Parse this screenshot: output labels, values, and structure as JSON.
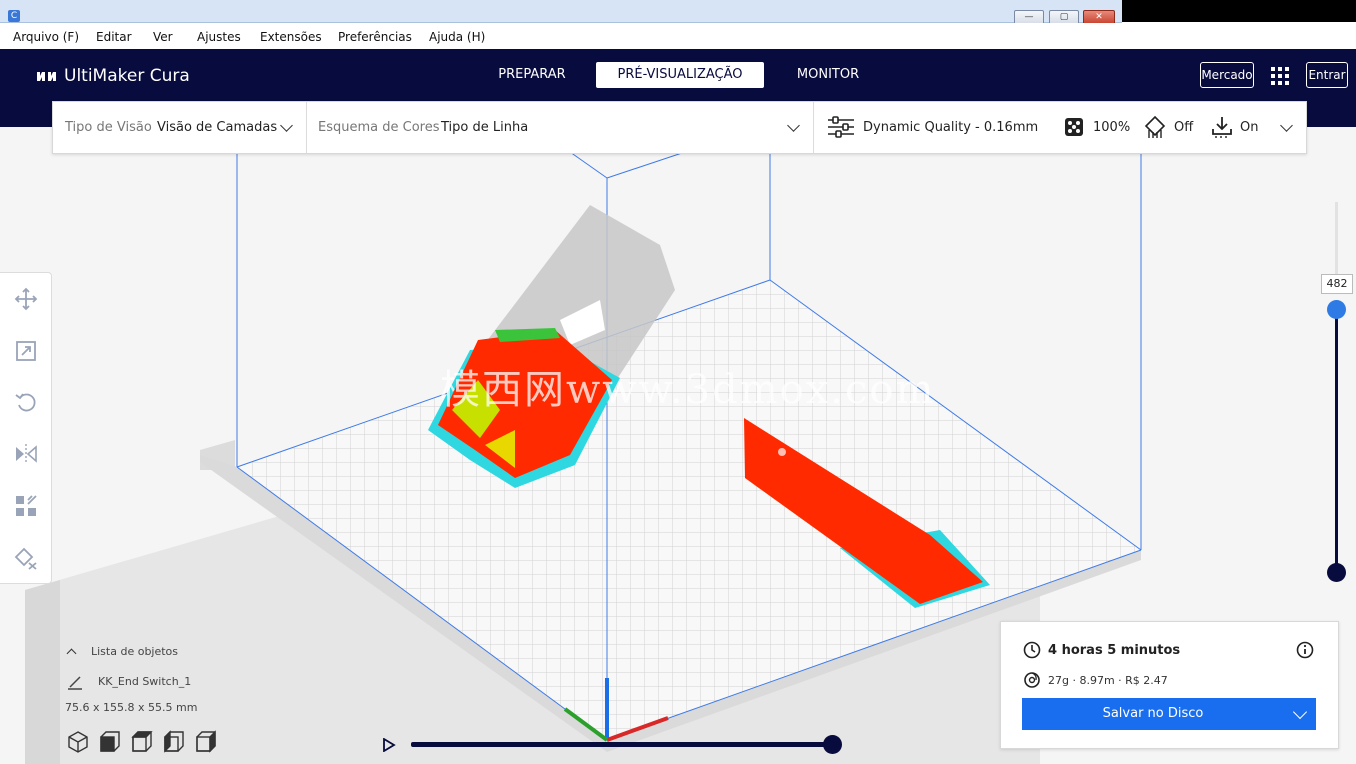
{
  "menu": [
    "Arquivo (F)",
    "Editar",
    "Ver",
    "Ajustes",
    "Extensões",
    "Preferências",
    "Ajuda (H)"
  ],
  "window": {
    "app_icon": "C"
  },
  "header": {
    "logo": "UltiMaker Cura",
    "tabs": [
      "PREPARAR",
      "PRÉ-VISUALIZAÇÃO",
      "MONITOR"
    ],
    "active_tab": "PRÉ-VISUALIZAÇÃO",
    "marketplace": "Mercado",
    "signin": "Entrar"
  },
  "toppanel": {
    "view_type_label": "Tipo de Visão",
    "view_type_value": "Visão de Camadas",
    "color_scheme_label": "Esquema de Cores",
    "color_scheme_value": "Tipo de Linha",
    "profile": "Dynamic Quality - 0.16mm",
    "infill": "100%",
    "support": "Off",
    "adhesion": "On"
  },
  "viewport": {
    "watermark": "模西网www.3dmox.com"
  },
  "layer_slider": {
    "value": "482",
    "fill_fraction": 1.0
  },
  "object_list": {
    "header": "Lista de objetos",
    "item": "KK_End Switch_1",
    "dimensions": "75.6 x 155.8 x 55.5 mm"
  },
  "print_info": {
    "time": "4 horas 5 minutos",
    "material": "27g · 8.97m · R$ 2.47",
    "save_button": "Salvar no Disco"
  },
  "colors": {
    "header_bg": "#080b3d",
    "accent_blue": "#196ef0",
    "wall_red": "#ff2a00",
    "skirt_cyan": "#2fd7e0"
  }
}
